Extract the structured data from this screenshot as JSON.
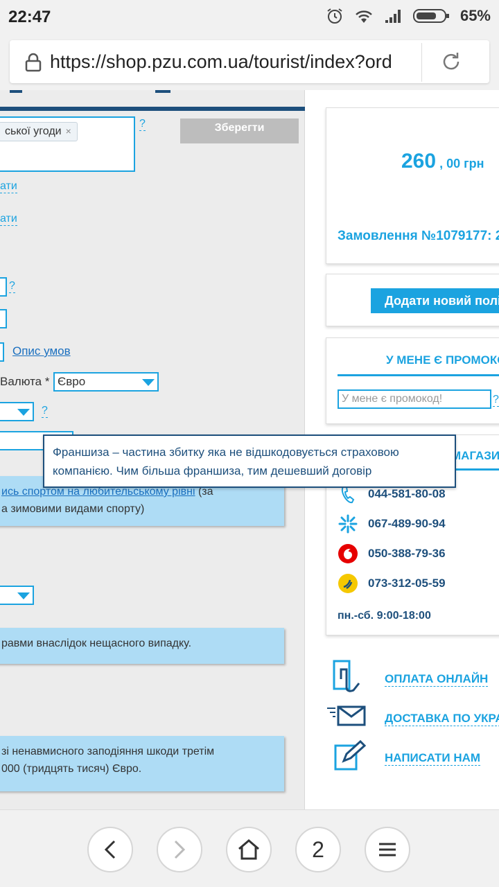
{
  "status": {
    "time": "22:47",
    "battery": "65%"
  },
  "browser": {
    "url": "https://shop.pzu.com.ua/tourist/index?ord",
    "tab_count": "2"
  },
  "form": {
    "tag_text": "ської угоди",
    "tag_remove": "×",
    "help": "?",
    "save_label": "Зберегти",
    "link1": "ати",
    "link2": "ати",
    "conditions_link": "Опис умов",
    "currency_label": "Валюта *",
    "currency_value": "Євро",
    "info_sport_link": "ись спортом на любительському рівні",
    "info_sport_suffix": " (за",
    "info_sport_line2": "а зимовими видами спорту)",
    "info_injury": "равми внаслідок нещасного випадку.",
    "info_liability_line1": "зі ненавмисного заподіяння шкоди третім",
    "info_liability_line2": "000 (тридцять тисяч) Євро."
  },
  "summary": {
    "price_main": "260",
    "price_rest": " , 00 грн",
    "order_label": "Замовлення №1079177: 2",
    "add_policy": "Додати новий полі",
    "promo_title": "У МЕНЕ Є ПРОМОКО",
    "promo_placeholder": "У мене є промокод!",
    "shops_title": "МАГАЗИ",
    "phones": [
      {
        "icon": "phone-icon",
        "number": "044-581-80-08"
      },
      {
        "icon": "kyivstar-icon",
        "number": "067-489-90-94"
      },
      {
        "icon": "vodafone-icon",
        "number": "050-388-79-36"
      },
      {
        "icon": "lifecell-icon",
        "number": "073-312-05-59"
      }
    ],
    "hours": "пн.-сб. 9:00-18:00"
  },
  "side_links": {
    "pay_online": "ОПЛАТА ОНЛАЙН",
    "delivery": "ДОСТАВКА ПО УКРА",
    "write_us": "НАПИСАТИ НАМ"
  },
  "tooltip": {
    "text": "Франшиза – частина збитку яка не відшкодовується страховою компанією. Чим більша франшиза, тим дешевший договір"
  },
  "colors": {
    "accent": "#1ba3e0",
    "dark_blue": "#1d4f7c",
    "info_bg": "#aedcf5"
  }
}
